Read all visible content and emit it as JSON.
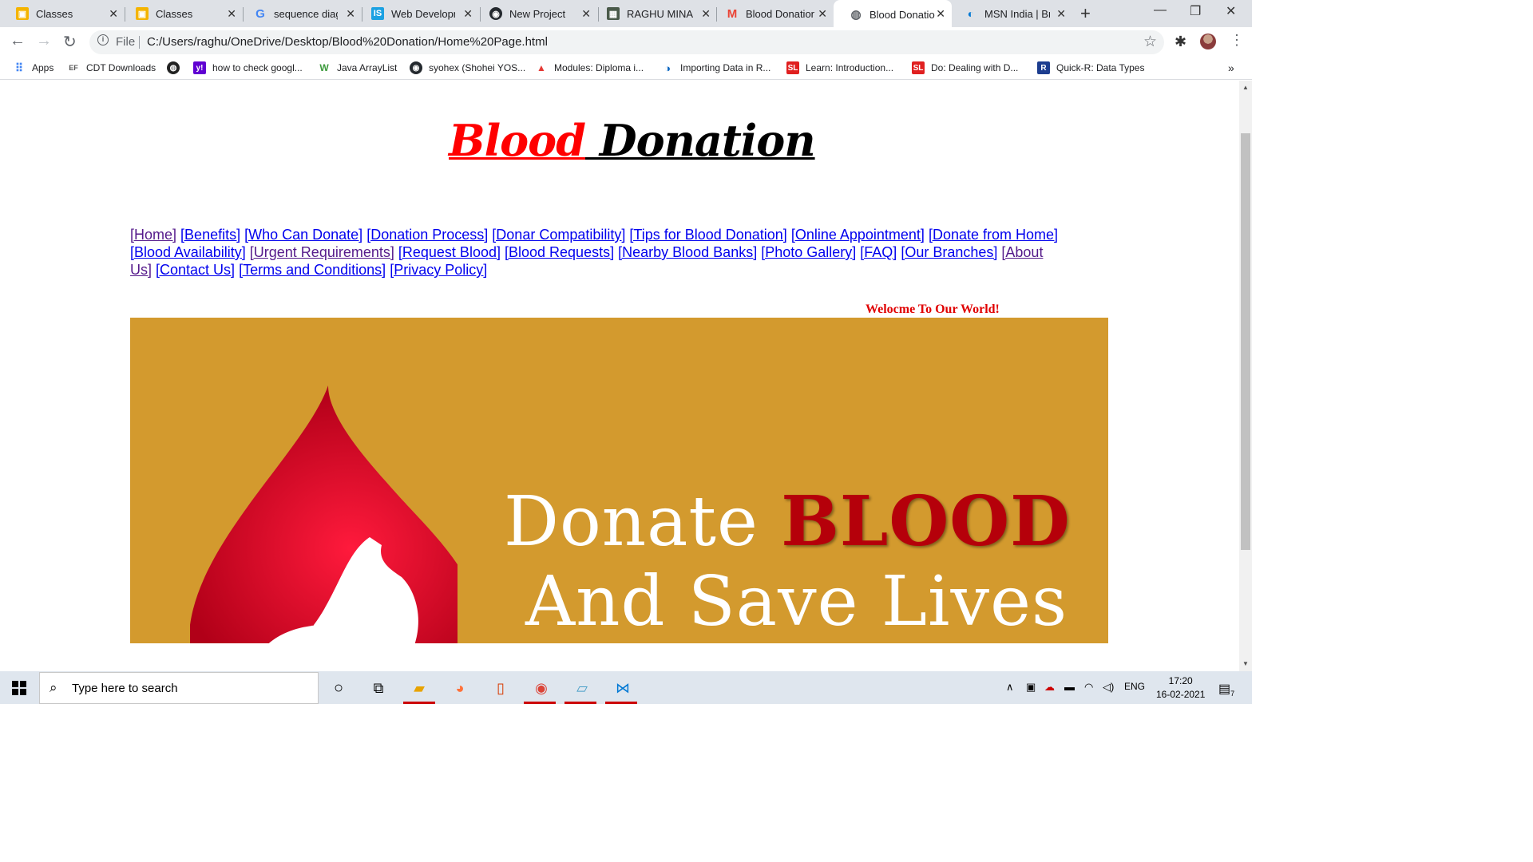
{
  "browser": {
    "tabs": [
      {
        "title": "Classes",
        "icon": "classroom-icon"
      },
      {
        "title": "Classes",
        "icon": "classroom-icon"
      },
      {
        "title": "sequence diagram",
        "icon": "google-icon"
      },
      {
        "title": "Web Development",
        "icon": "is-icon"
      },
      {
        "title": "New Project",
        "icon": "github-icon"
      },
      {
        "title": "RAGHU MINA",
        "icon": "profile-icon"
      },
      {
        "title": "Blood Donation",
        "icon": "gmail-icon"
      },
      {
        "title": "Blood Donation",
        "icon": "globe-icon"
      },
      {
        "title": "MSN India | Breaking",
        "icon": "msn-icon"
      }
    ],
    "file_label": "File",
    "url": "C:/Users/raghu/OneDrive/Desktop/Blood%20Donation/Home%20Page.html",
    "bookmarks": [
      {
        "label": "Apps"
      },
      {
        "label": "CDT Downloads"
      },
      {
        "label": ""
      },
      {
        "label": "how to check googl..."
      },
      {
        "label": "Java ArrayList"
      },
      {
        "label": "syohex (Shohei YOS..."
      },
      {
        "label": "Modules: Diploma i..."
      },
      {
        "label": "Importing Data in R..."
      },
      {
        "label": "Learn: Introduction..."
      },
      {
        "label": "Do: Dealing with D..."
      },
      {
        "label": "Quick-R: Data Types"
      }
    ],
    "bookmarks_more": "»"
  },
  "page": {
    "title_part1": "Blood",
    "title_part2": " Donation",
    "nav": [
      "[Home]",
      "[Benefits]",
      "[Who Can Donate]",
      "[Donation Process]",
      "[Donar Compatibility]",
      "[Tips for Blood Donation]",
      "[Online Appointment]",
      "[Donate from Home]",
      "[Blood Availability]",
      "[Urgent Requirements]",
      "[Request Blood]",
      "[Blood Requests]",
      "[Nearby Blood Banks]",
      "[Photo Gallery]",
      "[FAQ]",
      "[Our Branches]",
      "[About Us]",
      "[Contact Us]",
      "[Terms and Conditions]",
      "[Privacy Policy]"
    ],
    "welcome": "Welocme To Our World!",
    "banner_line1_a": "Donate ",
    "banner_line1_b": "BLOOD",
    "banner_line2": "And Save Lives",
    "banner_color": "#d39a2e"
  },
  "taskbar": {
    "search_placeholder": "Type here to search",
    "lang": "ENG",
    "time": "17:20",
    "date": "16-02-2021",
    "notifications": "7"
  }
}
